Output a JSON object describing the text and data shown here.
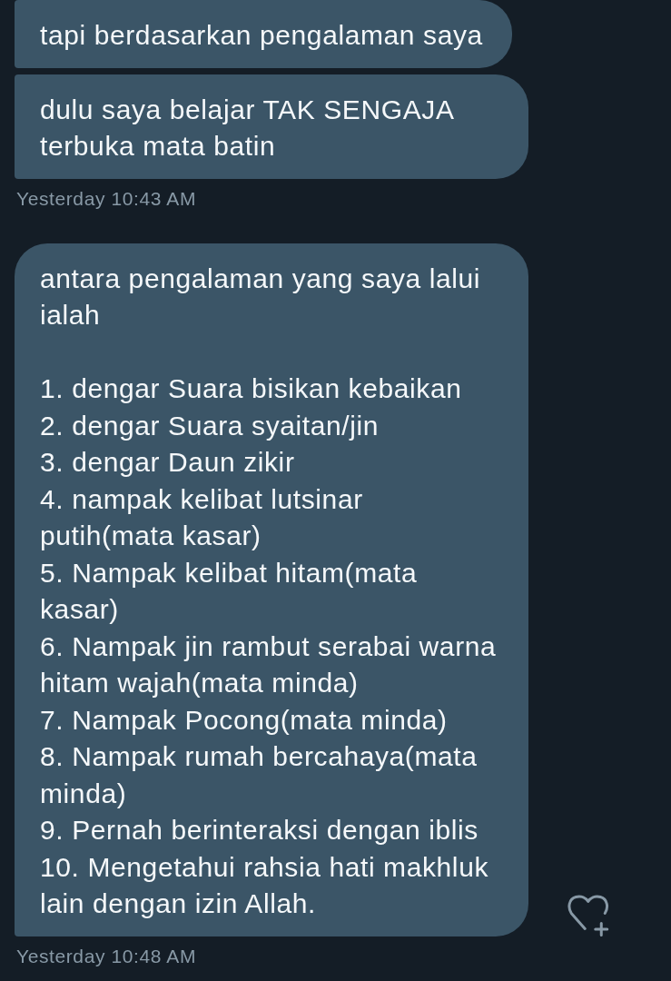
{
  "conversation": [
    {
      "bubbles": [
        {
          "text": "tapi berdasarkan pengalaman saya"
        },
        {
          "text": "dulu saya belajar TAK SENGAJA terbuka mata batin"
        }
      ],
      "timestamp": "Yesterday 10:43 AM",
      "like_button": false
    },
    {
      "bubbles": [
        {
          "text": "antara pengalaman yang saya lalui ialah",
          "items": [
            "1. dengar Suara bisikan kebaikan",
            "2. dengar Suara syaitan/jin",
            "3. dengar Daun zikir",
            "4. nampak kelibat lutsinar putih(mata kasar)",
            "5. Nampak kelibat hitam(mata kasar)",
            "6. Nampak jin rambut serabai warna hitam wajah(mata minda)",
            "7. Nampak Pocong(mata minda)",
            "8. Nampak rumah bercahaya(mata minda)",
            "9. Pernah berinteraksi dengan iblis",
            "10. Mengetahui rahsia hati makhluk lain dengan izin Allah."
          ]
        }
      ],
      "timestamp": "Yesterday 10:48 AM",
      "like_button": true
    }
  ]
}
